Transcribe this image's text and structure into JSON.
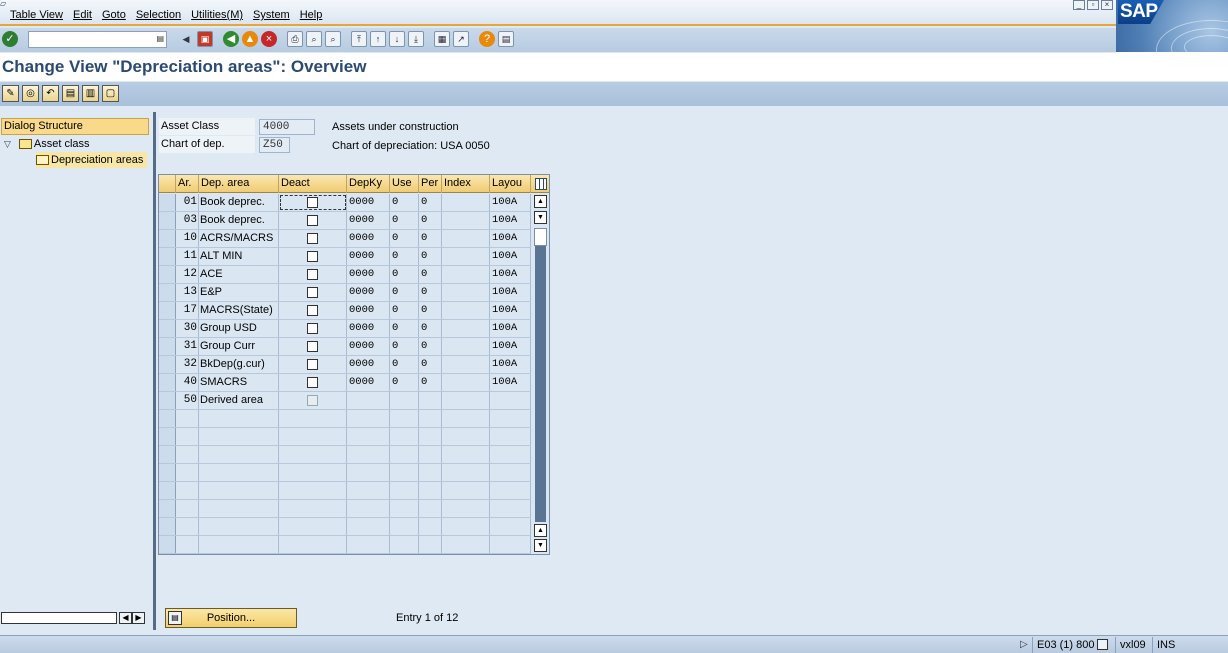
{
  "menu": [
    "Table View",
    "Edit",
    "Goto",
    "Selection",
    "Utilities(M)",
    "System",
    "Help"
  ],
  "logo_text": "SAP",
  "title": "Change View \"Depreciation areas\": Overview",
  "tree": {
    "header": "Dialog Structure",
    "items": [
      "Asset class",
      "Depreciation areas"
    ]
  },
  "header_fields": {
    "asset_class_label": "Asset Class",
    "asset_class_value": "4000",
    "asset_class_desc": "Assets under construction",
    "chart_label": "Chart of dep.",
    "chart_value": "Z50",
    "chart_desc": "Chart of depreciation: USA 0050"
  },
  "table": {
    "columns": [
      "Ar.",
      "Dep. area",
      "Deact",
      "DepKy",
      "Use",
      "Per",
      "Index",
      "Layou"
    ],
    "rows": [
      {
        "ar": "01",
        "area": "Book deprec.",
        "depky": "0000",
        "use": "0",
        "per": "0",
        "index": "",
        "layout": "100A"
      },
      {
        "ar": "03",
        "area": "Book deprec.",
        "depky": "0000",
        "use": "0",
        "per": "0",
        "index": "",
        "layout": "100A"
      },
      {
        "ar": "10",
        "area": "ACRS/MACRS",
        "depky": "0000",
        "use": "0",
        "per": "0",
        "index": "",
        "layout": "100A"
      },
      {
        "ar": "11",
        "area": "ALT MIN",
        "depky": "0000",
        "use": "0",
        "per": "0",
        "index": "",
        "layout": "100A"
      },
      {
        "ar": "12",
        "area": "ACE",
        "depky": "0000",
        "use": "0",
        "per": "0",
        "index": "",
        "layout": "100A"
      },
      {
        "ar": "13",
        "area": "E&P",
        "depky": "0000",
        "use": "0",
        "per": "0",
        "index": "",
        "layout": "100A"
      },
      {
        "ar": "17",
        "area": "MACRS(State)",
        "depky": "0000",
        "use": "0",
        "per": "0",
        "index": "",
        "layout": "100A"
      },
      {
        "ar": "30",
        "area": "Group USD",
        "depky": "0000",
        "use": "0",
        "per": "0",
        "index": "",
        "layout": "100A"
      },
      {
        "ar": "31",
        "area": "Group Curr",
        "depky": "0000",
        "use": "0",
        "per": "0",
        "index": "",
        "layout": "100A"
      },
      {
        "ar": "32",
        "area": "BkDep(g.cur)",
        "depky": "0000",
        "use": "0",
        "per": "0",
        "index": "",
        "layout": "100A"
      },
      {
        "ar": "40",
        "area": "SMACRS",
        "depky": "0000",
        "use": "0",
        "per": "0",
        "index": "",
        "layout": "100A"
      },
      {
        "ar": "50",
        "area": "Derived area",
        "depky": "",
        "use": "",
        "per": "",
        "index": "",
        "layout": ""
      }
    ],
    "empty_rows": 8
  },
  "position_button": "Position...",
  "entry_text": "Entry 1 of 12",
  "status": {
    "system": "E03 (1) 800",
    "server": "vxl09",
    "mode": "INS"
  }
}
